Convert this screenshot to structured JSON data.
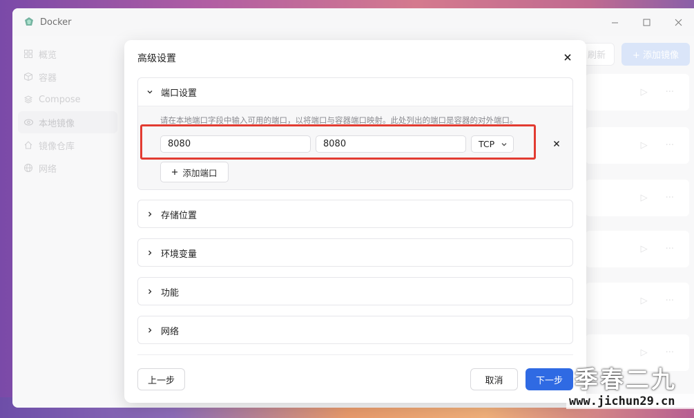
{
  "app": {
    "title": "Docker"
  },
  "window_controls": {
    "minimize": "—",
    "maximize": "☐",
    "close": "✕"
  },
  "sidebar": {
    "items": [
      {
        "label": "概览",
        "icon": "grid-icon",
        "active": false
      },
      {
        "label": "容器",
        "icon": "cube-icon",
        "active": false
      },
      {
        "label": "Compose",
        "icon": "layers-icon",
        "active": false
      },
      {
        "label": "本地镜像",
        "icon": "eye-icon",
        "active": true
      },
      {
        "label": "镜像仓库",
        "icon": "home-icon",
        "active": false
      },
      {
        "label": "网络",
        "icon": "globe-icon",
        "active": false
      }
    ]
  },
  "toolbar": {
    "refresh_label": "刷新",
    "add_image_label": "+ 添加镜像"
  },
  "dialog": {
    "title": "高级设置",
    "sections": [
      {
        "label": "端口设置",
        "expanded": true
      },
      {
        "label": "存储位置",
        "expanded": false
      },
      {
        "label": "环境变量",
        "expanded": false
      },
      {
        "label": "功能",
        "expanded": false
      },
      {
        "label": "网络",
        "expanded": false
      }
    ],
    "port_settings": {
      "hint": "请在本地端口字段中输入可用的端口，以将端口与容器端口映射。此处列出的端口是容器的对外端口。",
      "local_port": "8080",
      "container_port": "8080",
      "protocol": "TCP",
      "add_port_label": "添加端口"
    },
    "footer": {
      "prev_label": "上一步",
      "cancel_label": "取消",
      "next_label": "下一步"
    }
  },
  "watermark": {
    "text": "季春二九",
    "url": "www.jichun29.cn"
  },
  "colors": {
    "accent": "#2f6ae3",
    "highlight": "#e23b31"
  }
}
